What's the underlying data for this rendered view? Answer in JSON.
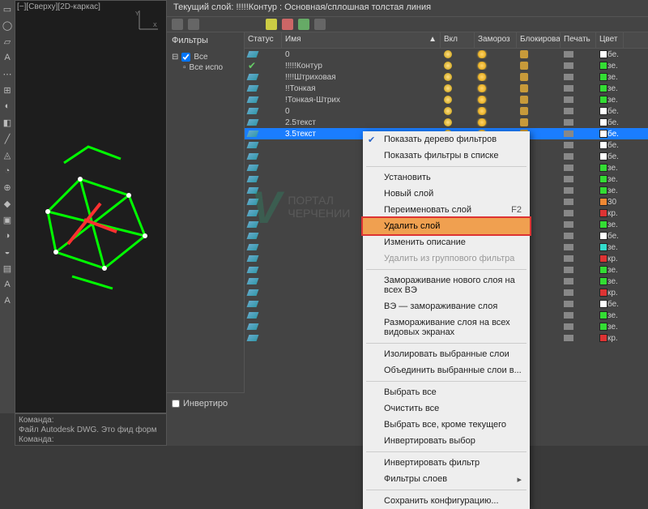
{
  "viewport": {
    "label": "[−][Сверху][2D-каркас]"
  },
  "cmd": {
    "l1": "Команда:",
    "l2": "Файл Autodesk DWG. Это фид форм",
    "l3": "Команда:"
  },
  "panel": {
    "title": "Текущий слой: !!!!!Контур : Основная/сплошная толстая линия",
    "filters_label": "Фильтры",
    "tree": {
      "all": "Все",
      "used": "Все испо"
    },
    "invert": "Инвертиро"
  },
  "cols": {
    "status": "Статус",
    "name": "Имя",
    "on": "Вкл",
    "freeze": "Замороз",
    "lock": "Блокирова",
    "plot": "Печать",
    "color": "Цвет"
  },
  "layers": [
    {
      "name": "0",
      "sel": false,
      "c": "#ffffff",
      "cl": "бе."
    },
    {
      "name": "!!!!!Контур",
      "sel": false,
      "c": "#33dd33",
      "cl": "зе."
    },
    {
      "name": "!!!!Штриховая",
      "sel": false,
      "c": "#33dd33",
      "cl": "зе."
    },
    {
      "name": "!!Тонкая",
      "sel": false,
      "c": "#33dd33",
      "cl": "зе."
    },
    {
      "name": "!Тонкая-Штрих",
      "sel": false,
      "c": "#33dd33",
      "cl": "зе."
    },
    {
      "name": "0",
      "sel": false,
      "c": "#ffffff",
      "cl": "бе."
    },
    {
      "name": "2.5текст",
      "sel": false,
      "c": "#ffffff",
      "cl": "бе."
    },
    {
      "name": "3.5текст",
      "sel": true,
      "c": "#ffffff",
      "cl": "бе."
    },
    {
      "name": "",
      "c": "#ffffff",
      "cl": "бе."
    },
    {
      "name": "",
      "c": "#ffffff",
      "cl": "бе."
    },
    {
      "name": "",
      "c": "#33dd33",
      "cl": "зе."
    },
    {
      "name": "",
      "c": "#33dd33",
      "cl": "зе."
    },
    {
      "name": "",
      "c": "#33dd33",
      "cl": "зе."
    },
    {
      "name": "",
      "c": "#ee8833",
      "cl": "30"
    },
    {
      "name": "",
      "c": "#dd3333",
      "cl": "кр."
    },
    {
      "name": "",
      "c": "#33dd33",
      "cl": "зе."
    },
    {
      "name": "",
      "c": "#ffffff",
      "cl": "бе."
    },
    {
      "name": "",
      "c": "#33ddcc",
      "cl": "зе."
    },
    {
      "name": "",
      "c": "#dd3333",
      "cl": "кр."
    },
    {
      "name": "",
      "c": "#33dd33",
      "cl": "зе."
    },
    {
      "name": "",
      "c": "#33dd33",
      "cl": "зе."
    },
    {
      "name": "",
      "c": "#dd3333",
      "cl": "кр."
    },
    {
      "name": "",
      "c": "#ffffff",
      "cl": "бе."
    },
    {
      "name": "",
      "c": "#33dd33",
      "cl": "зе."
    },
    {
      "name": "",
      "c": "#33dd33",
      "cl": "зе."
    },
    {
      "name": "",
      "c": "#dd3333",
      "cl": "кр."
    }
  ],
  "ctx": [
    {
      "t": "Показать дерево фильтров",
      "checked": true
    },
    {
      "t": "Показать фильтры в списке"
    },
    {
      "sep": true
    },
    {
      "t": "Установить"
    },
    {
      "t": "Новый слой"
    },
    {
      "t": "Переименовать слой",
      "shortcut": "F2"
    },
    {
      "t": "Удалить слой",
      "hot": true
    },
    {
      "t": "Изменить описание"
    },
    {
      "t": "Удалить из группового фильтра",
      "disabled": true
    },
    {
      "sep": true
    },
    {
      "t": "Замораживание нового слоя на всех ВЭ"
    },
    {
      "t": "ВЭ — замораживание слоя"
    },
    {
      "t": "Размораживание слоя на всех видовых экранах"
    },
    {
      "sep": true
    },
    {
      "t": "Изолировать выбранные слои"
    },
    {
      "t": "Объединить выбранные слои в..."
    },
    {
      "sep": true
    },
    {
      "t": "Выбрать все"
    },
    {
      "t": "Очистить все"
    },
    {
      "t": "Выбрать все, кроме текущего"
    },
    {
      "t": "Инвертировать выбор"
    },
    {
      "sep": true
    },
    {
      "t": "Инвертировать фильтр"
    },
    {
      "t": "Фильтры слоев",
      "arrow": true
    },
    {
      "sep": true
    },
    {
      "t": "Сохранить конфигурацию..."
    }
  ],
  "watermark": {
    "v": "V",
    "line1": "ПОРТАЛ",
    "line2": "ЧЕРЧЕНИИ"
  }
}
